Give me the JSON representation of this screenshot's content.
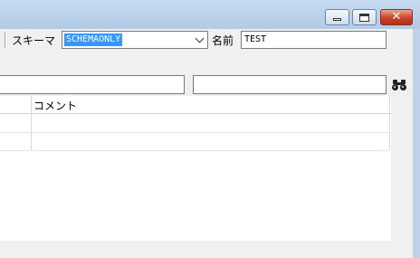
{
  "window": {
    "controls": {
      "minimize": "minimize-icon",
      "maximize": "maximize-icon",
      "close": "close-icon"
    }
  },
  "toolbar": {
    "schema_label": "スキーマ",
    "schema_value": "SCHEMAONLY",
    "name_label": "名前",
    "name_value": "TEST"
  },
  "filter": {
    "left_value": "",
    "right_value": "",
    "find_icon": "binoculars-icon"
  },
  "grid": {
    "columns": [
      "",
      "コメント"
    ],
    "rows": [
      [
        "",
        ""
      ],
      [
        "",
        ""
      ]
    ]
  },
  "colors": {
    "title_bar": "#bcd3ea",
    "client_bg": "#f0f0f0",
    "selection": "#3399ff",
    "close_button": "#c8432a"
  }
}
